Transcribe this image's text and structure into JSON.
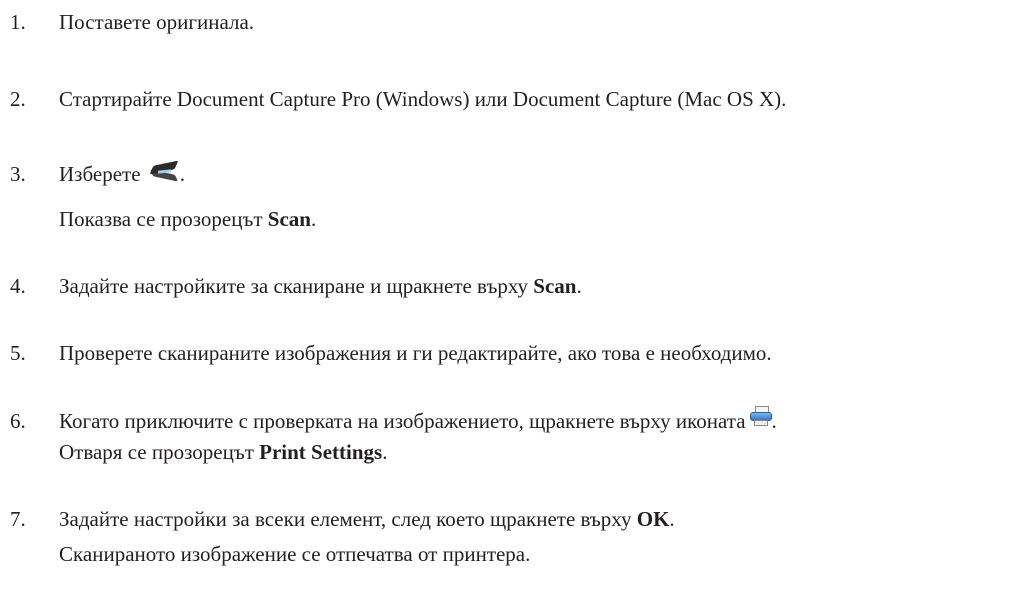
{
  "steps": [
    {
      "num": "1.",
      "text": "Поставете оригинала."
    },
    {
      "num": "2.",
      "text": "Стартирайте Document Capture Pro (Windows) или Document Capture (Mac OS X)."
    },
    {
      "num": "3.",
      "text_before": "Изберете",
      "icon": "scan-icon",
      "text_after": ".",
      "note_before": "Показва се прозорецът ",
      "note_bold": "Scan",
      "note_after": "."
    },
    {
      "num": "4.",
      "text_before": "Задайте настройките за сканиране и щракнете върху ",
      "bold": "Scan",
      "text_after": "."
    },
    {
      "num": "5.",
      "text": "Проверете сканираните изображения и ги редактирайте, ако това е необходимо."
    },
    {
      "num": "6.",
      "text_before": "Когато приключите с проверката на изображението, щракнете върху иконата",
      "icon": "printer-icon",
      "text_after": ".",
      "note_before": "Отваря се прозорецът ",
      "note_bold": "Print Settings",
      "note_after": "."
    },
    {
      "num": "7.",
      "text_before": "Задайте настройки за всеки елемент, след което щракнете върху ",
      "bold": "OK",
      "text_after": ".",
      "note": "Сканираното изображение се отпечатва от принтера."
    }
  ]
}
